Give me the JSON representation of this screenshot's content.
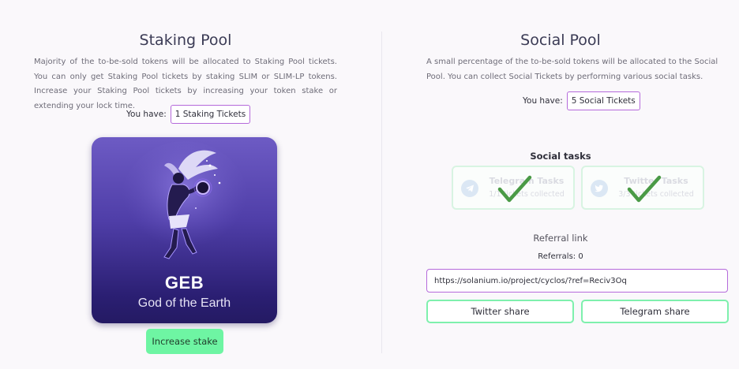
{
  "staking": {
    "title": "Staking Pool",
    "description": "Majority of the to-be-sold tokens will be allocated to Staking Pool tickets. You can only get Staking Pool tickets by staking SLIM or SLIM-LP tokens. Increase your Staking Pool tickets by increasing your token stake or extending your lock time.",
    "you_have_label": "You have:",
    "tickets": "1 Staking Tickets",
    "nft": {
      "title": "GEB",
      "subtitle": "God of the Earth"
    },
    "increase_button": "Increase stake"
  },
  "social": {
    "title": "Social Pool",
    "description": "A small percentage of the to-be-sold tokens will be allocated to the Social Pool. You can collect Social Tickets by performing various social tasks.",
    "you_have_label": "You have:",
    "tickets": "5 Social Tickets",
    "tasks_title": "Social tasks",
    "tasks": [
      {
        "name": "Telegram Tasks",
        "status": "1/1 tickets collected",
        "icon": "telegram-icon",
        "completed": true
      },
      {
        "name": "Twitter Tasks",
        "status": "3/3 tickets collected",
        "icon": "twitter-icon",
        "completed": true
      }
    ],
    "referral_title": "Referral link",
    "referrals_label": "Referrals: 0",
    "referral_url": "https://solanium.io/project/cyclos/?ref=Reciv3Oq",
    "twitter_share": "Twitter share",
    "telegram_share": "Telegram share"
  },
  "colors": {
    "accent_border": "#b56adb",
    "green_button": "#6ef5a3",
    "check_green": "#4a9a46"
  }
}
